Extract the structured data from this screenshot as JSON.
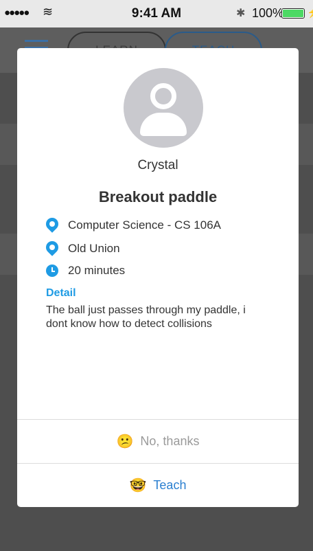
{
  "status_bar": {
    "signal": "●●●●●",
    "wifi": "≋",
    "time": "9:41 AM",
    "bluetooth": "✱",
    "battery": "100%",
    "battery_level": 1.0
  },
  "background": {
    "tabs": [
      "LEARN",
      "TEACH"
    ],
    "active_tab": "TEACH"
  },
  "request": {
    "user_name": "Crystal",
    "title": "Breakout paddle",
    "course": "Computer Science - CS 106A",
    "location": "Old Union",
    "duration": "20 minutes",
    "detail_label": "Detail",
    "detail_text": "The ball just passes through my paddle, i dont know how to detect collisions"
  },
  "actions": {
    "decline_label": "No, thanks",
    "decline_emoji": "😕",
    "accept_label": "Teach",
    "accept_emoji": "🤓"
  },
  "colors": {
    "accent": "#1e9be4",
    "teach_text": "#2a7fd0",
    "decline_text": "#9a9a9a"
  }
}
